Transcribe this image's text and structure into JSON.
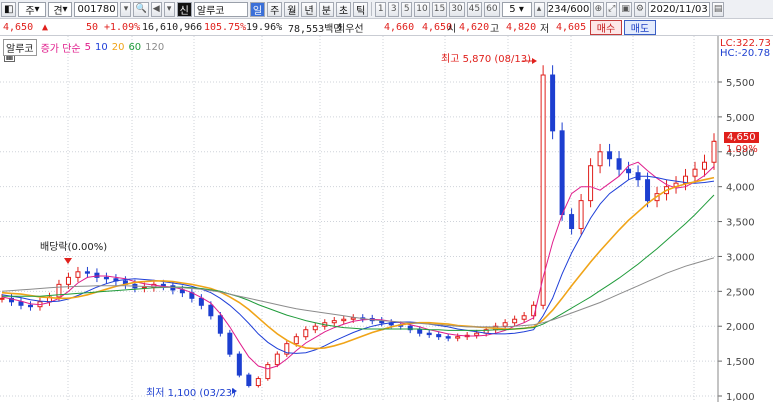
{
  "toolbar": {
    "market": "주",
    "type": "견",
    "code": "001780",
    "stock_name": "알루코",
    "periods": [
      "일",
      "주",
      "월",
      "년",
      "분",
      "초",
      "틱"
    ],
    "active_period": "일",
    "minutes": [
      "1",
      "3",
      "5",
      "10",
      "15",
      "30",
      "45",
      "60"
    ],
    "count_select": "5",
    "range": "234/600",
    "date": "2020/11/03"
  },
  "quote": {
    "price": "4,650",
    "arrow": "▲",
    "change": "50",
    "change_pct": "+1.09%",
    "volume": "16,610,966",
    "vol_ratio": "105.75%",
    "turnover": "19.96%",
    "amount": "78,553백만",
    "best_label": "최우선",
    "best_ask": "4,660",
    "best_bid": "4,650",
    "open_label": "시",
    "open": "4,620",
    "high_label": "고",
    "high": "4,820",
    "low_label": "저",
    "low": "4,605",
    "buy_label": "매수",
    "sell_label": "매도"
  },
  "legend": {
    "name": "알루코",
    "prefix": "증가 단순",
    "ma": [
      {
        "label": "5",
        "color": "#e01e8c"
      },
      {
        "label": "10",
        "color": "#1f3fd8"
      },
      {
        "label": "20",
        "color": "#f0a418"
      },
      {
        "label": "60",
        "color": "#1f9b3a"
      },
      {
        "label": "120",
        "color": "#8c8c8c"
      }
    ]
  },
  "annotations": {
    "high": "최고 5,870 (08/13)",
    "low": "최저 1,100 (03/23)",
    "dividend": "배당락(0.00%)",
    "lc": "LC:322.73",
    "hc": "HC:-20.78",
    "last_price": "4,650",
    "last_pct": "1.09%"
  },
  "colors": {
    "up": "#e0201c",
    "down": "#1d3fd0",
    "ma5": "#e01e8c",
    "ma10": "#1f3fd8",
    "ma20": "#f0a418",
    "ma60": "#1f9b3a",
    "ma120": "#8c8c8c"
  },
  "chart_data": {
    "type": "line",
    "ylim": [
      1000,
      5900
    ],
    "y_ticks": [
      "1,000",
      "1,500",
      "2,000",
      "2,500",
      "3,000",
      "3,500",
      "4,000",
      "4,500",
      "5,000",
      "5,500"
    ],
    "y_tick_values": [
      1000,
      1500,
      2000,
      2500,
      3000,
      3500,
      4000,
      4500,
      5000,
      5500
    ],
    "series": [
      {
        "key": "close",
        "values": [
          2400,
          2350,
          2300,
          2280,
          2350,
          2420,
          2600,
          2700,
          2780,
          2760,
          2700,
          2680,
          2650,
          2600,
          2550,
          2560,
          2600,
          2580,
          2520,
          2480,
          2400,
          2300,
          2150,
          1900,
          1600,
          1300,
          1150,
          1250,
          1450,
          1600,
          1750,
          1850,
          1950,
          2000,
          2050,
          2080,
          2100,
          2120,
          2110,
          2080,
          2050,
          2020,
          2000,
          1950,
          1900,
          1880,
          1850,
          1830,
          1850,
          1870,
          1900,
          1950,
          2000,
          2050,
          2100,
          2150,
          2300,
          5600,
          4800,
          3600,
          3400,
          3800,
          4300,
          4500,
          4400,
          4250,
          4200,
          4100,
          3800,
          3900,
          4000,
          4050,
          4150,
          4250,
          4350,
          4650
        ]
      },
      {
        "key": "ma5",
        "values": [
          2420,
          2390,
          2360,
          2320,
          2310,
          2340,
          2400,
          2500,
          2620,
          2700,
          2720,
          2720,
          2700,
          2680,
          2640,
          2610,
          2590,
          2570,
          2560,
          2530,
          2480,
          2410,
          2330,
          2180,
          1990,
          1770,
          1560,
          1430,
          1390,
          1430,
          1530,
          1650,
          1760,
          1840,
          1920,
          1980,
          2030,
          2070,
          2090,
          2100,
          2090,
          2070,
          2050,
          2020,
          1990,
          1950,
          1920,
          1890,
          1870,
          1860,
          1860,
          1870,
          1900,
          1940,
          2000,
          2050,
          2120,
          2700,
          3200,
          3600,
          3900,
          4000,
          4000,
          3950,
          4050,
          4150,
          4300,
          4350,
          4230,
          4120,
          4030,
          3980,
          4000,
          4070,
          4160,
          4290
        ]
      },
      {
        "key": "ma10",
        "values": [
          2450,
          2430,
          2410,
          2380,
          2360,
          2350,
          2360,
          2390,
          2440,
          2500,
          2560,
          2610,
          2650,
          2670,
          2680,
          2670,
          2660,
          2640,
          2620,
          2600,
          2570,
          2530,
          2480,
          2400,
          2300,
          2180,
          2040,
          1890,
          1770,
          1680,
          1620,
          1610,
          1620,
          1660,
          1720,
          1790,
          1850,
          1910,
          1960,
          2000,
          2030,
          2050,
          2060,
          2060,
          2050,
          2030,
          2010,
          1990,
          1960,
          1940,
          1920,
          1900,
          1890,
          1890,
          1900,
          1920,
          1950,
          2150,
          2400,
          2750,
          3050,
          3300,
          3550,
          3750,
          3900,
          4000,
          4100,
          4150,
          4150,
          4130,
          4100,
          4080,
          4060,
          4050,
          4060,
          4080
        ]
      },
      {
        "key": "ma20",
        "values": [
          2480,
          2470,
          2460,
          2440,
          2420,
          2410,
          2400,
          2400,
          2420,
          2450,
          2490,
          2530,
          2570,
          2600,
          2630,
          2640,
          2650,
          2650,
          2640,
          2620,
          2600,
          2570,
          2540,
          2490,
          2420,
          2340,
          2240,
          2120,
          2000,
          1890,
          1800,
          1730,
          1690,
          1680,
          1690,
          1720,
          1760,
          1810,
          1860,
          1910,
          1950,
          1990,
          2020,
          2040,
          2050,
          2050,
          2040,
          2030,
          2010,
          2000,
          1990,
          1980,
          1970,
          1960,
          1960,
          1970,
          1990,
          2090,
          2230,
          2400,
          2580,
          2750,
          2920,
          3080,
          3230,
          3380,
          3520,
          3640,
          3760,
          3860,
          3950,
          4000,
          4040,
          4070,
          4100,
          4130
        ]
      },
      {
        "key": "ma60",
        "values": [
          2430,
          2430,
          2430,
          2430,
          2430,
          2440,
          2450,
          2460,
          2470,
          2480,
          2490,
          2500,
          2510,
          2520,
          2530,
          2540,
          2550,
          2555,
          2560,
          2560,
          2550,
          2540,
          2520,
          2500,
          2460,
          2420,
          2370,
          2310,
          2260,
          2210,
          2160,
          2120,
          2080,
          2050,
          2020,
          2000,
          1980,
          1970,
          1960,
          1960,
          1960,
          1960,
          1960,
          1960,
          1960,
          1950,
          1950,
          1940,
          1940,
          1940,
          1940,
          1940,
          1950,
          1950,
          1960,
          1970,
          1980,
          2030,
          2100,
          2180,
          2260,
          2340,
          2420,
          2510,
          2600,
          2690,
          2790,
          2890,
          3000,
          3110,
          3230,
          3350,
          3470,
          3600,
          3740,
          3880
        ]
      },
      {
        "key": "ma120",
        "values": [
          2500,
          2510,
          2520,
          2530,
          2540,
          2550,
          2560,
          2565,
          2570,
          2575,
          2580,
          2580,
          2580,
          2580,
          2575,
          2570,
          2565,
          2560,
          2555,
          2550,
          2540,
          2530,
          2510,
          2490,
          2460,
          2430,
          2400,
          2370,
          2340,
          2310,
          2280,
          2250,
          2230,
          2210,
          2190,
          2170,
          2150,
          2130,
          2110,
          2090,
          2080,
          2070,
          2060,
          2050,
          2040,
          2030,
          2020,
          2010,
          2000,
          1990,
          1990,
          1990,
          1990,
          1990,
          2000,
          2010,
          2020,
          2050,
          2090,
          2140,
          2190,
          2240,
          2290,
          2340,
          2400,
          2460,
          2520,
          2580,
          2640,
          2700,
          2760,
          2810,
          2860,
          2900,
          2940,
          2980
        ]
      }
    ]
  }
}
